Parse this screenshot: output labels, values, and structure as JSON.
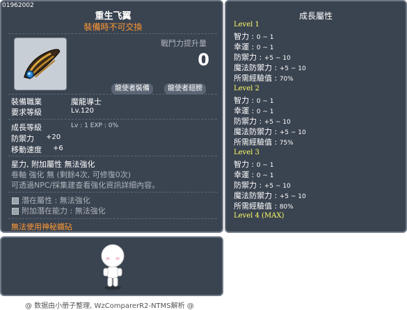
{
  "item": {
    "id": "01962002",
    "name": "重生飞翼",
    "trade_note": "裝備時不可交換",
    "power_label": "戰鬥力提升量",
    "power_value": "0",
    "job_buttons": [
      "龍使者裝備",
      "龍使者翅膀"
    ],
    "req_job_label": "裝備職業",
    "req_job_value": "魔龍導士",
    "req_level_label": "要求等級",
    "req_level_value": "Lv.120",
    "growth_label": "成長等級",
    "growth_value": "Lv : 1  EXP : 0%",
    "def_label": "防禦力",
    "def_value": "+20",
    "speed_label": "移動速度",
    "speed_value": "+6",
    "starforce": "星力, 附加屬性 無法強化",
    "scroll_info": "卷軸 強化 無 (剩餘4次, 可修復0次)",
    "npc_note": "可透過NPC/採集建查看強化資訊詳細內容。",
    "potential_label": "潛在屬性 : 無法強化",
    "add_potential_label": "附加潛在能力 : 無法強化",
    "no_mystic": "無法使用神秘鐵砧"
  },
  "growth": {
    "title": "成長屬性",
    "levels": [
      {
        "label": "Level 1",
        "stats": [
          {
            "name": "智力 : ",
            "value": "0 ~ 1"
          },
          {
            "name": "幸運 : ",
            "value": "0 ~ 1"
          },
          {
            "name": "防禦力 : ",
            "value": "+5 ~ 10"
          },
          {
            "name": "魔法防禦力 : ",
            "value": "+5 ~ 10"
          },
          {
            "name": "所需經驗值 : ",
            "value": "70%"
          }
        ]
      },
      {
        "label": "Level 2",
        "stats": [
          {
            "name": "智力 : ",
            "value": "0 ~ 1"
          },
          {
            "name": "幸運 : ",
            "value": "0 ~ 1"
          },
          {
            "name": "防禦力 : ",
            "value": "+5 ~ 10"
          },
          {
            "name": "魔法防禦力 : ",
            "value": "+5 ~ 10"
          },
          {
            "name": "所需經驗值 : ",
            "value": "75%"
          }
        ]
      },
      {
        "label": "Level 3",
        "stats": [
          {
            "name": "智力 : ",
            "value": "0 ~ 1"
          },
          {
            "name": "幸運 : ",
            "value": "0 ~ 1"
          },
          {
            "name": "防禦力 : ",
            "value": "+5 ~ 10"
          },
          {
            "name": "魔法防禦力 : ",
            "value": "+5 ~ 10"
          },
          {
            "name": "所需經驗值 : ",
            "value": "80%"
          }
        ]
      },
      {
        "label": "Level 4 (MAX)",
        "stats": []
      }
    ]
  },
  "footer": "@ 数据由小册子整理, WzComparerR2-NTMS解析 @",
  "colors": {
    "panel_bg": "#3a4350",
    "panel_border": "#6e7886",
    "orange": "#ff9933",
    "yellow": "#ffff66",
    "muted": "#aeb4bc"
  },
  "icons": {
    "item": "golden-wing-icon",
    "avatar": "character-avatar"
  }
}
